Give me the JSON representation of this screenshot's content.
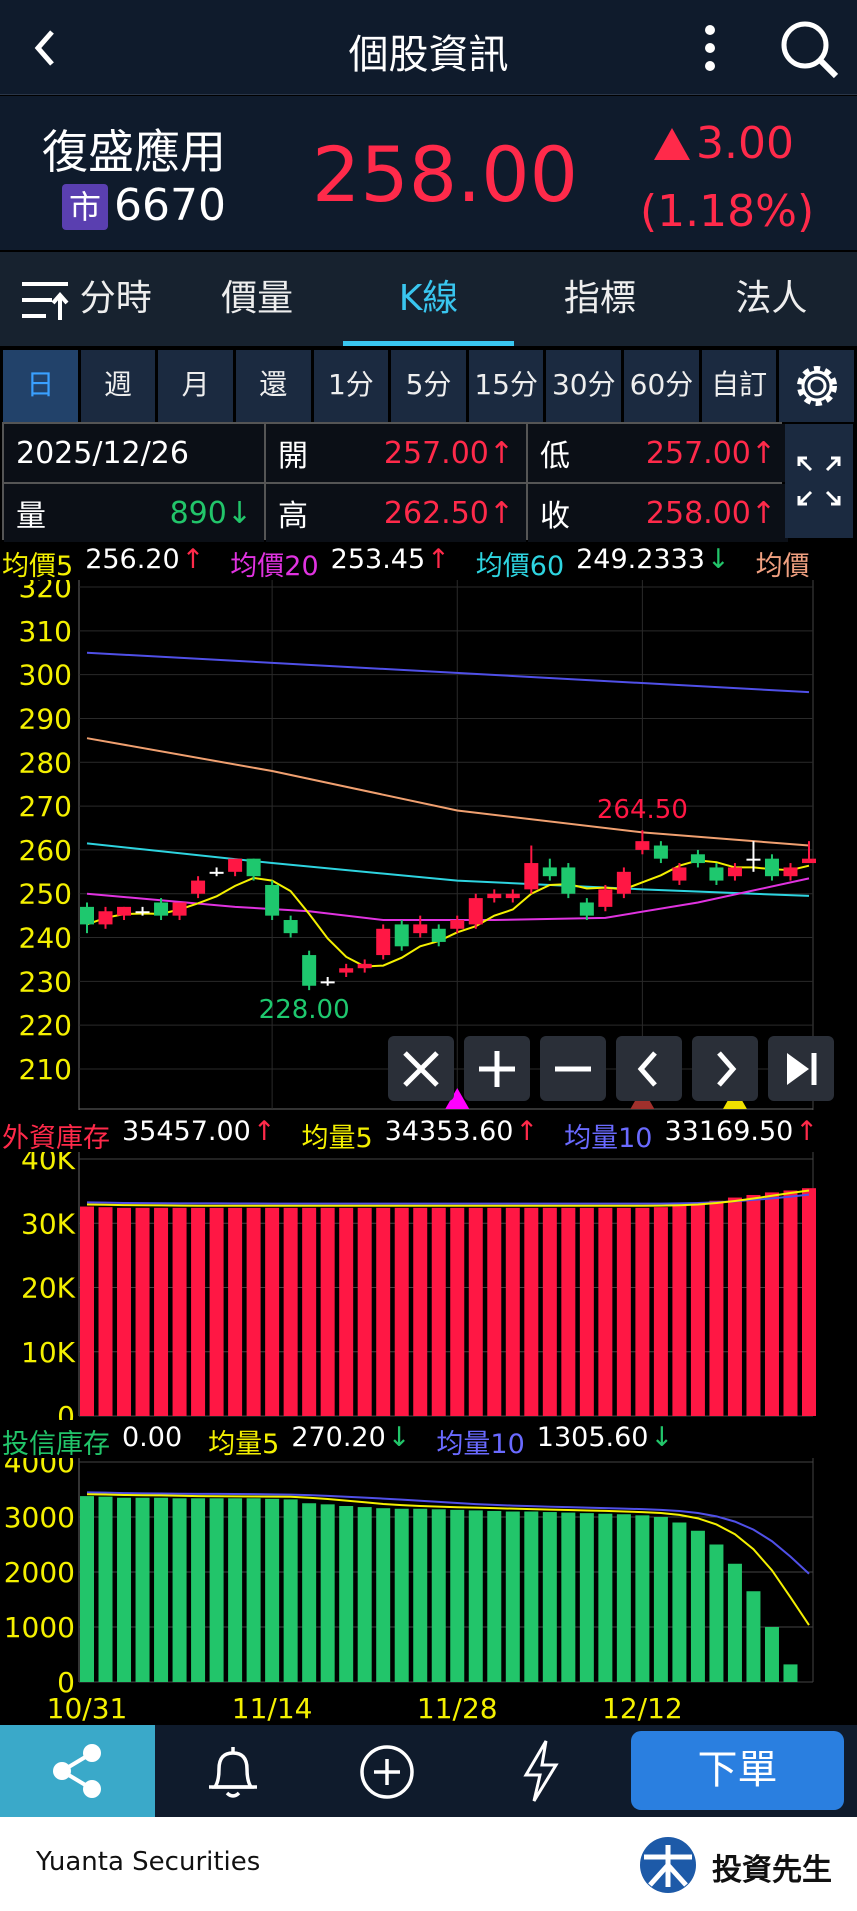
{
  "header": {
    "title": "個股資訊",
    "back_icon": "chevron-left",
    "menu_icon": "more-vertical",
    "search_icon": "search"
  },
  "quote": {
    "name": "復盛應用",
    "market_badge": "市",
    "code": "6670",
    "price": "258.00",
    "change": "3.00",
    "change_pct": "(1.18%)",
    "up_color": "#ff2a4a"
  },
  "tabs": [
    {
      "label": "分時"
    },
    {
      "label": "價量"
    },
    {
      "label": "K線",
      "selected": true
    },
    {
      "label": "指標"
    },
    {
      "label": "法人"
    }
  ],
  "periods": [
    "日",
    "週",
    "月",
    "還",
    "1分",
    "5分",
    "15分",
    "30分",
    "60分",
    "自訂"
  ],
  "info": {
    "date": "2025/12/26",
    "open_label": "開",
    "open": "257.00↑",
    "low_label": "低",
    "low": "257.00↑",
    "vol_label": "量",
    "vol": "890↓",
    "high_label": "高",
    "high": "262.50↑",
    "close_label": "收",
    "close": "258.00↑"
  },
  "ma": {
    "ma5_label": "均價5",
    "ma5": "256.20",
    "ma5_arrow": "↑",
    "ma20_label": "均價20",
    "ma20": "253.45",
    "ma20_arrow": "↑",
    "ma60_label": "均價60",
    "ma60": "249.2333",
    "ma60_arrow": "↓",
    "ma_more_label": "均價"
  },
  "foreign": {
    "label": "外資庫存",
    "value": "35457.00",
    "arrow": "↑",
    "avg5_label": "均量5",
    "avg5": "34353.60",
    "avg5_arrow": "↑",
    "avg10_label": "均量10",
    "avg10": "33169.50",
    "avg10_arrow": "↑"
  },
  "trust": {
    "label": "投信庫存",
    "value": "0.00",
    "avg5_label": "均量5",
    "avg5": "270.20",
    "avg5_arrow": "↓",
    "avg10_label": "均量10",
    "avg10": "1305.60",
    "avg10_arrow": "↓"
  },
  "toolbar": {
    "order_label": "下單"
  },
  "footer": {
    "brand": "Yuanta Securities",
    "app_name": "投資先生"
  },
  "chart_data": [
    {
      "type": "candlestick",
      "yticks": [
        320,
        310,
        300,
        290,
        280,
        270,
        260,
        250,
        240,
        230,
        220,
        210
      ],
      "ylim": [
        210,
        320
      ],
      "ohlc": [
        [
          247,
          248,
          241,
          243
        ],
        [
          243,
          247,
          242,
          246
        ],
        [
          245,
          247,
          244,
          247
        ],
        [
          246,
          247,
          245,
          246
        ],
        [
          248,
          249,
          244,
          245
        ],
        [
          245,
          248,
          244,
          248
        ],
        [
          250,
          254,
          249,
          253
        ],
        [
          255,
          256,
          254,
          255
        ],
        [
          255,
          258,
          254,
          258
        ],
        [
          258,
          258,
          253,
          254
        ],
        [
          252,
          253,
          244,
          245
        ],
        [
          244,
          245,
          240,
          241
        ],
        [
          236,
          237,
          228,
          229
        ],
        [
          230,
          231,
          229,
          230
        ],
        [
          232,
          234,
          231,
          233
        ],
        [
          233,
          235,
          232,
          234
        ],
        [
          236,
          243,
          235,
          242
        ],
        [
          243,
          244,
          237,
          238
        ],
        [
          241,
          245,
          240,
          243
        ],
        [
          242,
          243,
          238,
          239
        ],
        [
          242,
          245,
          241,
          244
        ],
        [
          243,
          250,
          242,
          249
        ],
        [
          249,
          251,
          248,
          250
        ],
        [
          249,
          251,
          248,
          250
        ],
        [
          251,
          261,
          250,
          257
        ],
        [
          256,
          258,
          253,
          254
        ],
        [
          256,
          257,
          249,
          250
        ],
        [
          248,
          249,
          244,
          245
        ],
        [
          247,
          252,
          246,
          251
        ],
        [
          250,
          256,
          249,
          255
        ],
        [
          260,
          264.5,
          259,
          262
        ],
        [
          261,
          262,
          257,
          258
        ],
        [
          253,
          257,
          252,
          256
        ],
        [
          259,
          260,
          256,
          257
        ],
        [
          256,
          257,
          252,
          253
        ],
        [
          254,
          257,
          253,
          256
        ],
        [
          258,
          262,
          255,
          258
        ],
        [
          258,
          259,
          253,
          254
        ],
        [
          254,
          257,
          253,
          256
        ],
        [
          257,
          262,
          257,
          258
        ]
      ],
      "annotations": [
        {
          "text": "264.50",
          "index": 30,
          "value": 264.5
        },
        {
          "text": "228.00",
          "index": 12,
          "value": 228
        }
      ],
      "ma_lines": {
        "ma_blue": [
          [
            0,
            305
          ],
          [
            39,
            296
          ]
        ],
        "ma_orange": [
          [
            0,
            285.5
          ],
          [
            10,
            278
          ],
          [
            20,
            269
          ],
          [
            30,
            264
          ],
          [
            39,
            261
          ]
        ],
        "ma_cyan": [
          [
            0,
            261.5
          ],
          [
            10,
            257
          ],
          [
            20,
            253
          ],
          [
            30,
            251
          ],
          [
            39,
            249.5
          ]
        ],
        "ma_magenta": [
          [
            0,
            250
          ],
          [
            8,
            247
          ],
          [
            12,
            246
          ],
          [
            16,
            244
          ],
          [
            22,
            244
          ],
          [
            28,
            244.5
          ],
          [
            33,
            248
          ],
          [
            39,
            253.5
          ]
        ]
      },
      "markers": [
        {
          "index": 20,
          "color": "#ff00ff"
        },
        {
          "index": 30,
          "color": "#a0302c"
        },
        {
          "index": 35,
          "color": "#f0e000"
        }
      ]
    },
    {
      "type": "bar",
      "name": "外資庫存",
      "yticks": [
        "40K",
        "30K",
        "20K",
        "10K",
        "0"
      ],
      "ylim": [
        0,
        40000
      ],
      "values": [
        32600,
        32500,
        32400,
        32400,
        32400,
        32400,
        32400,
        32400,
        32400,
        32400,
        32400,
        32400,
        32400,
        32400,
        32400,
        32400,
        32400,
        32400,
        32400,
        32400,
        32400,
        32400,
        32400,
        32400,
        32400,
        32400,
        32400,
        32400,
        32400,
        32400,
        32400,
        32500,
        32700,
        33000,
        33500,
        34000,
        34400,
        34800,
        35100,
        35457
      ]
    },
    {
      "type": "bar",
      "name": "投信庫存",
      "yticks": [
        "4000",
        "3000",
        "2000",
        "1000",
        "0"
      ],
      "ylim": [
        0,
        4000
      ],
      "xticks": [
        {
          "label": "10/31",
          "index": 0
        },
        {
          "label": "11/14",
          "index": 10
        },
        {
          "label": "11/28",
          "index": 20
        },
        {
          "label": "12/12",
          "index": 30
        }
      ],
      "values": [
        3380,
        3370,
        3350,
        3350,
        3350,
        3340,
        3340,
        3340,
        3340,
        3340,
        3330,
        3320,
        3250,
        3230,
        3200,
        3180,
        3160,
        3150,
        3150,
        3140,
        3130,
        3120,
        3110,
        3100,
        3100,
        3090,
        3080,
        3070,
        3060,
        3050,
        3030,
        3000,
        2900,
        2750,
        2500,
        2150,
        1650,
        1000,
        320,
        0
      ]
    }
  ]
}
